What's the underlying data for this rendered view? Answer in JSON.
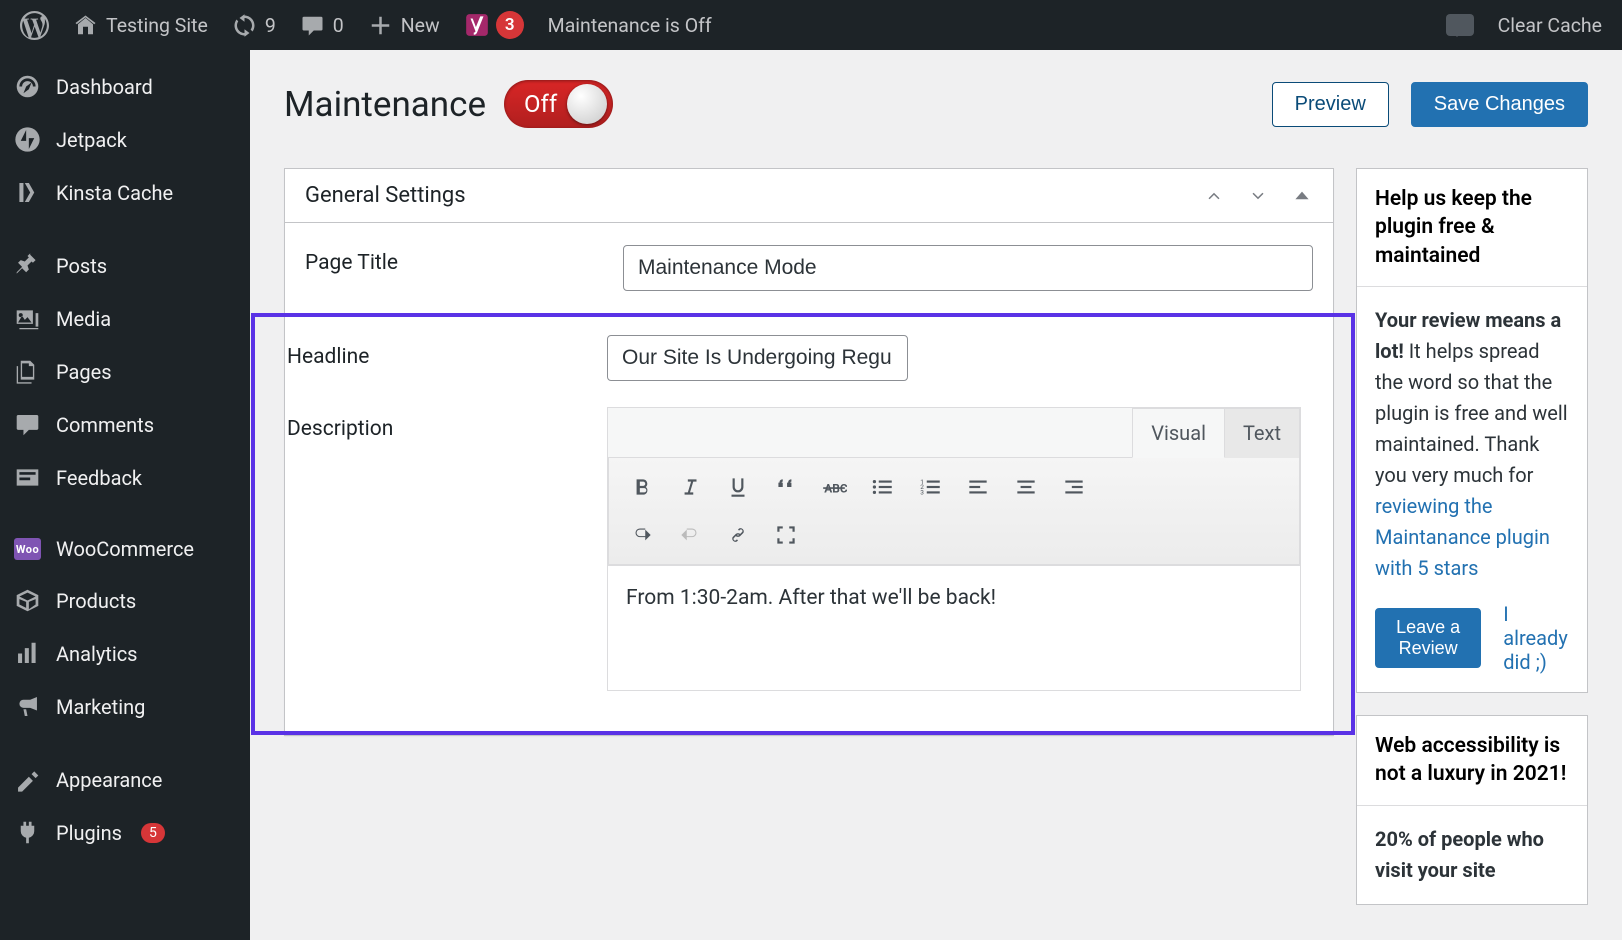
{
  "adminbar": {
    "site_name": "Testing Site",
    "updates": "9",
    "comments": "0",
    "new_label": "New",
    "yoast_count": "3",
    "maintenance_status": "Maintenance is Off",
    "clear_cache": "Clear Cache"
  },
  "sidebar": {
    "items": [
      {
        "label": "Dashboard"
      },
      {
        "label": "Jetpack"
      },
      {
        "label": "Kinsta Cache"
      },
      {
        "label": "Posts"
      },
      {
        "label": "Media"
      },
      {
        "label": "Pages"
      },
      {
        "label": "Comments"
      },
      {
        "label": "Feedback"
      },
      {
        "label": "WooCommerce"
      },
      {
        "label": "Products"
      },
      {
        "label": "Analytics"
      },
      {
        "label": "Marketing"
      },
      {
        "label": "Appearance"
      },
      {
        "label": "Plugins"
      }
    ],
    "plugins_count": "5"
  },
  "page": {
    "title": "Maintenance",
    "toggle_label": "Off",
    "preview": "Preview",
    "save": "Save Changes"
  },
  "panel": {
    "title": "General Settings",
    "page_title_label": "Page Title",
    "page_title_value": "Maintenance Mode",
    "headline_label": "Headline",
    "headline_value": "Our Site Is Undergoing Regular Maintenance",
    "description_label": "Description",
    "description_value": "From 1:30-2am. After that we'll be back!",
    "tab_visual": "Visual",
    "tab_text": "Text"
  },
  "sidepanel1": {
    "title": "Help us keep the plugin free & maintained",
    "body_strong": "Your review means a lot! ",
    "body_part1": "It helps spread the word so that the plugin is free and well maintained. Thank you very much for ",
    "link1": "reviewing the Maintanance plugin with 5 stars",
    "leave_review": "Leave a Review",
    "already": "I already did ;)"
  },
  "sidepanel2": {
    "title": "Web accessibility is not a luxury in 2021!",
    "body_pct": "20% of people who visit your site"
  }
}
